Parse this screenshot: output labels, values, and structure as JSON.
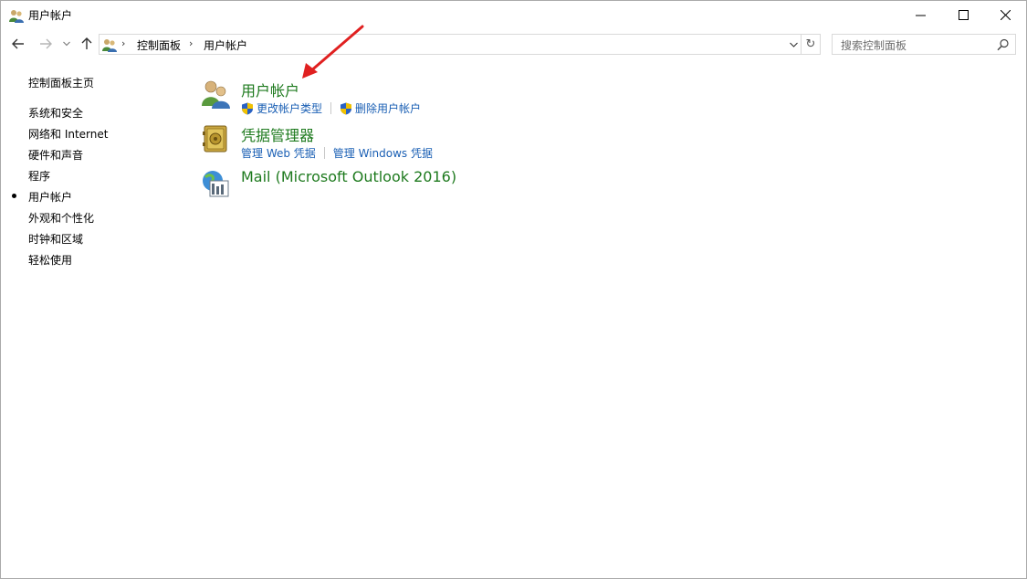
{
  "window": {
    "title": "用户帐户"
  },
  "nav": {
    "breadcrumbs": [
      "控制面板",
      "用户帐户"
    ],
    "search_placeholder": "搜索控制面板"
  },
  "left_pane": {
    "home_link": "控制面板主页",
    "links": [
      "系统和安全",
      "网络和 Internet",
      "硬件和声音",
      "程序",
      "用户帐户",
      "外观和个性化",
      "时钟和区域",
      "轻松使用"
    ],
    "current_index": 4
  },
  "categories": [
    {
      "title": "用户帐户",
      "icon": "users-icon",
      "tasks": [
        {
          "label": "更改帐户类型",
          "shield": true
        },
        {
          "label": "删除用户帐户",
          "shield": true
        }
      ]
    },
    {
      "title": "凭据管理器",
      "icon": "vault-icon",
      "tasks": [
        {
          "label": "管理 Web 凭据",
          "shield": false
        },
        {
          "label": "管理 Windows 凭据",
          "shield": false
        }
      ]
    },
    {
      "title": "Mail (Microsoft Outlook 2016)",
      "icon": "mail-icon",
      "tasks": []
    }
  ],
  "colors": {
    "category_title": "#1e7a1e",
    "task_link": "#1a5fb4",
    "annotation_arrow": "#e02020"
  }
}
